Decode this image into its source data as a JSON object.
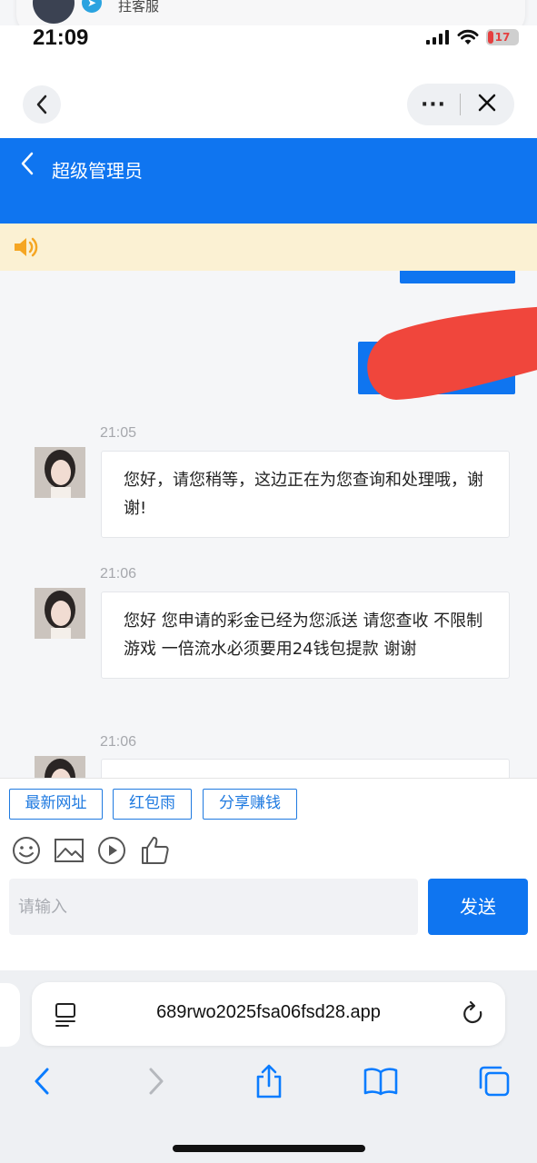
{
  "notification": {
    "text": "拄客服"
  },
  "status_bar": {
    "time": "21:09",
    "battery": "17"
  },
  "browser": {
    "more_label": "···",
    "close_label": "✕",
    "back_label": "‹"
  },
  "header": {
    "title": "超级管理员",
    "back_label": "‹"
  },
  "messages": [
    {
      "time": "21:05",
      "text": "您好，请您稍等，这边正在为您查询和处理哦，谢谢!"
    },
    {
      "time": "21:06",
      "text": "您好 您申请的彩金已经为您派送 请您查收 不限制游戏 一倍流水必须要用24钱包提款 谢谢"
    },
    {
      "time": "21:06",
      "text": ""
    }
  ],
  "quick_actions": [
    "最新网址",
    "红包雨",
    "分享赚钱"
  ],
  "input": {
    "placeholder": "请输入",
    "send_label": "发送"
  },
  "safari": {
    "url": "689rwo2025fsa06fsd28.app"
  },
  "colors": {
    "brand_blue": "#0f75f0",
    "notice_bg": "#fbf1d3",
    "redaction": "#f0463c"
  }
}
